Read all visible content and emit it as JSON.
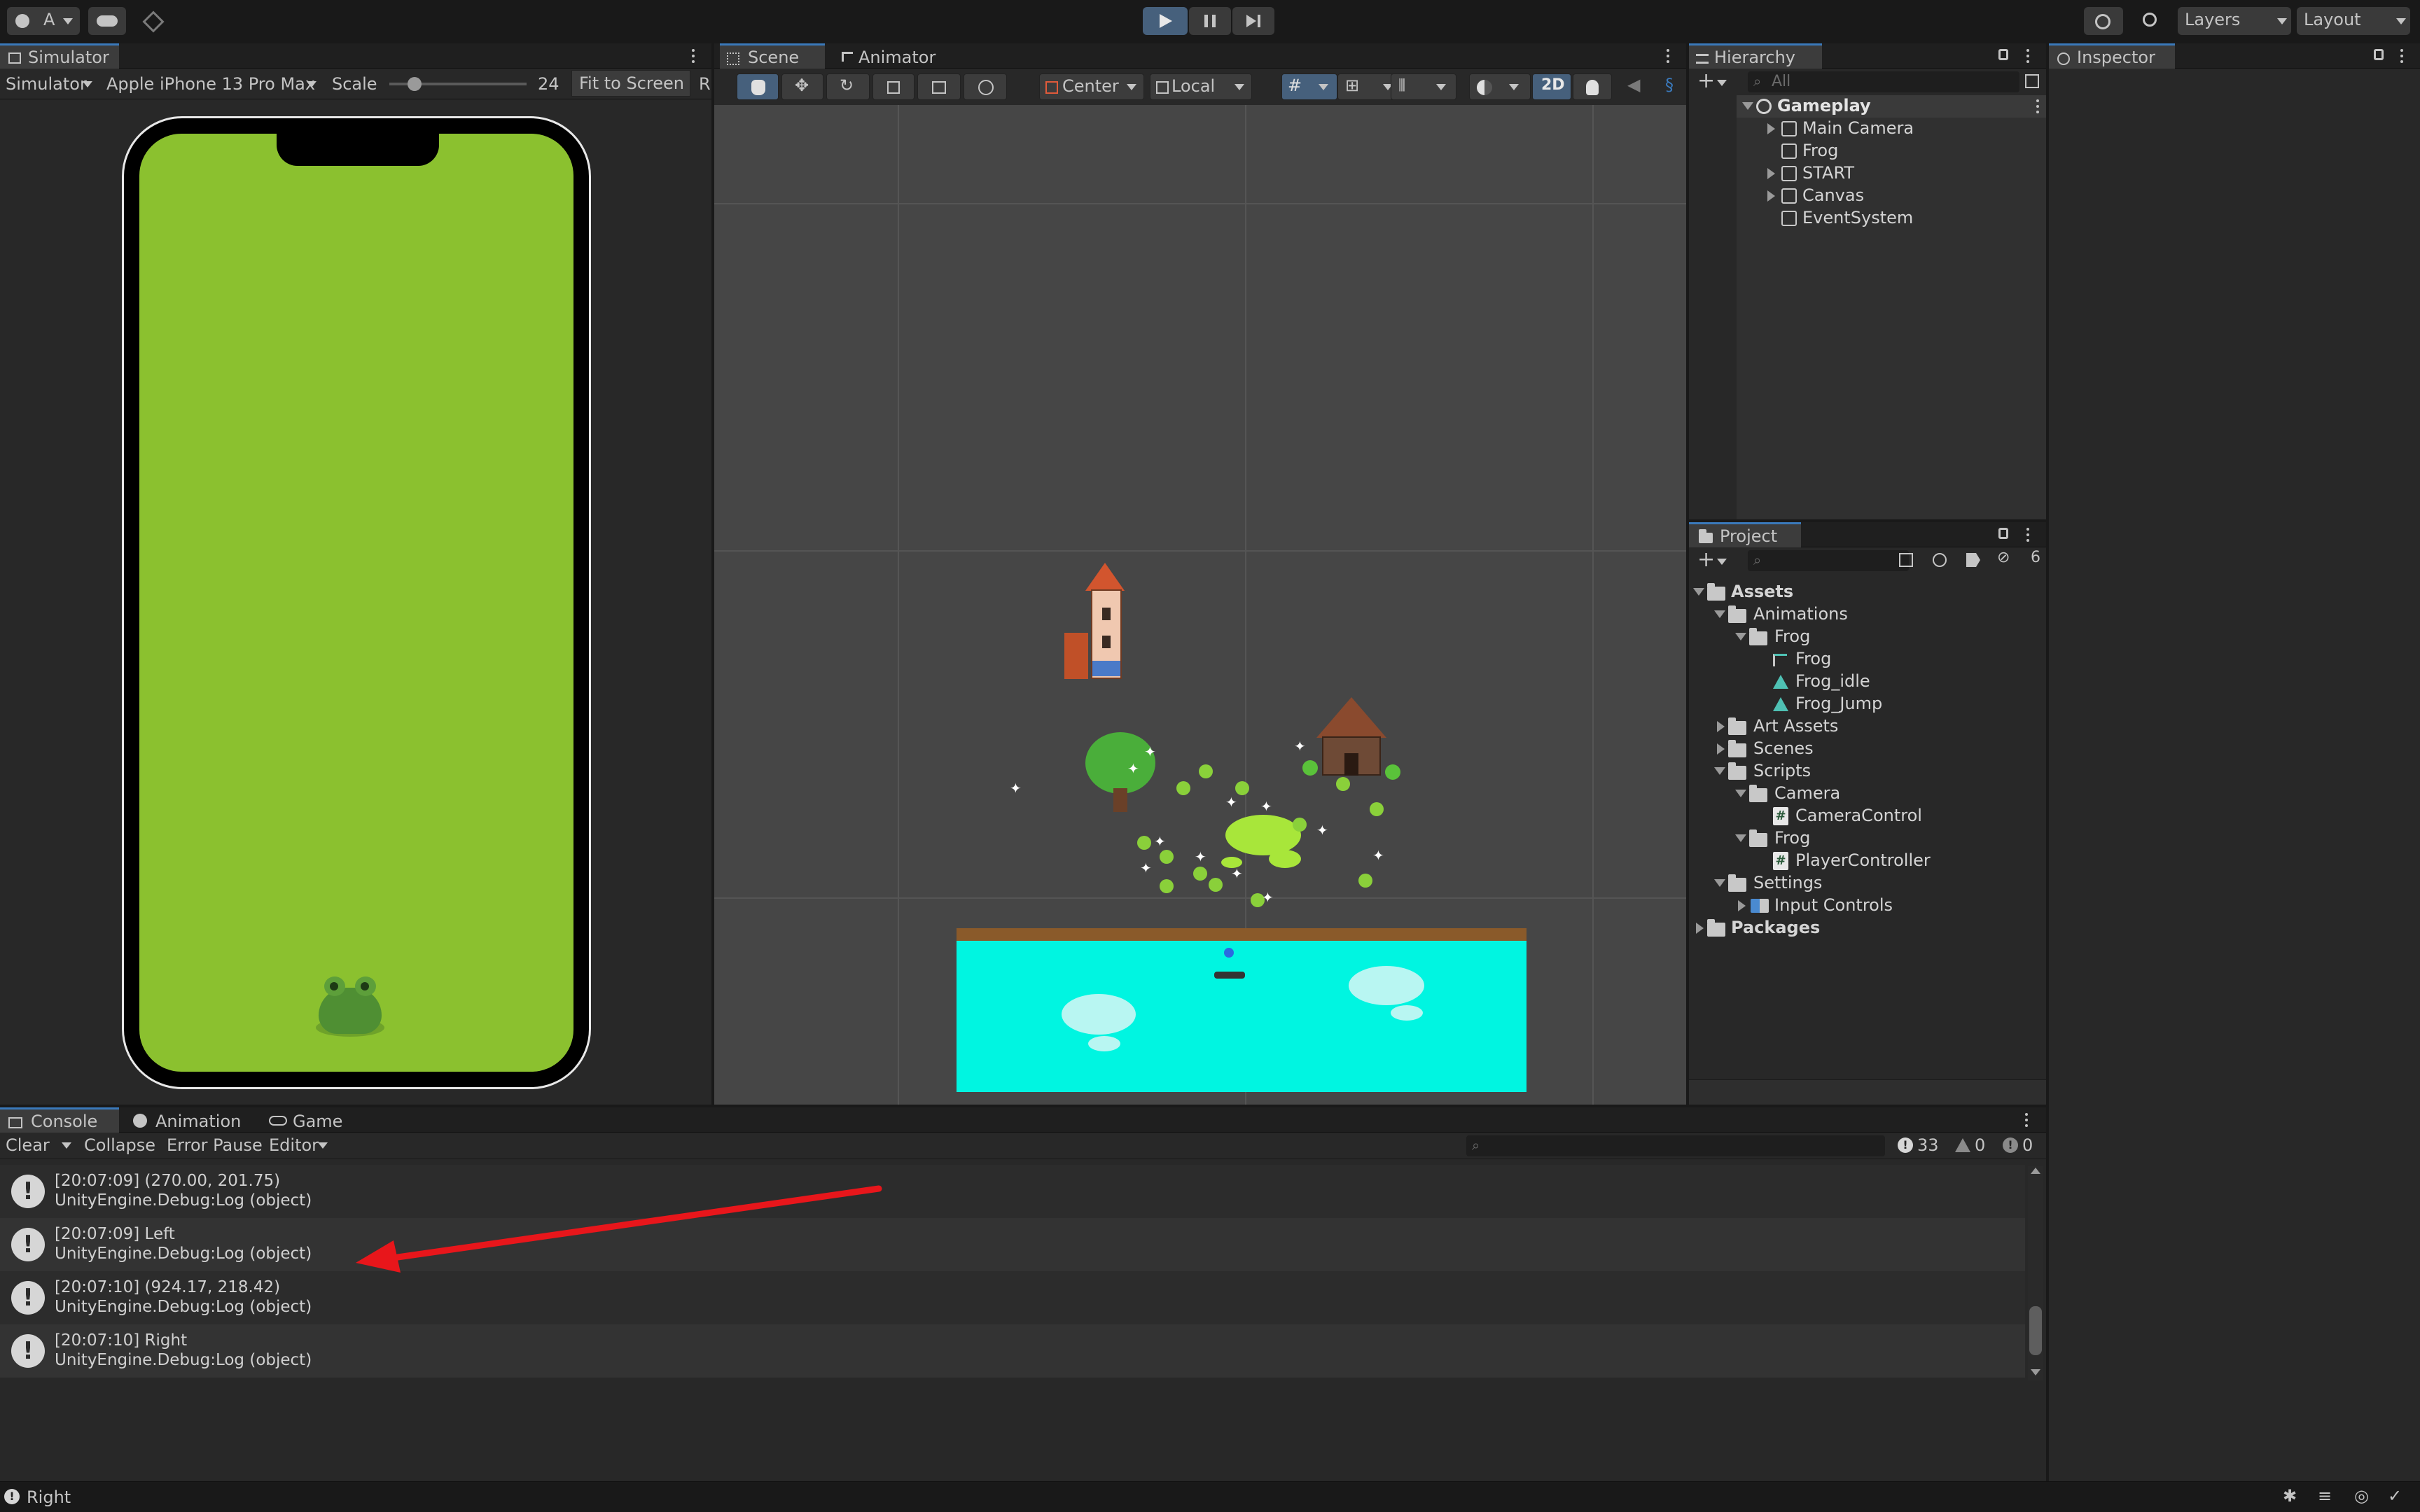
{
  "topbar": {
    "account_label": "A",
    "layers_label": "Layers",
    "layout_label": "Layout"
  },
  "simulator": {
    "tab_label": "Simulator",
    "mode_label": "Simulator",
    "device_label": "Apple iPhone 13 Pro Max",
    "scale_label": "Scale",
    "scale_value": "24",
    "fit_label": "Fit to Screen",
    "rotate_label": "R",
    "screen_color": "#8bc12f"
  },
  "scene": {
    "tabs": [
      "Scene",
      "Animator"
    ],
    "pivot_label": "Center",
    "space_label": "Local",
    "mode_2d_label": "2D"
  },
  "hierarchy": {
    "tab_label": "Hierarchy",
    "search_placeholder": "All",
    "root": "Gameplay",
    "items": [
      "Main Camera",
      "Frog",
      "START",
      "Canvas",
      "EventSystem"
    ]
  },
  "inspector": {
    "tab_label": "Inspector"
  },
  "project": {
    "tab_label": "Project",
    "hidden_count": "6",
    "tree": {
      "assets": "Assets",
      "animations": "Animations",
      "anim_frog_folder": "Frog",
      "anim_frog_controller": "Frog",
      "frog_idle": "Frog_idle",
      "frog_jump": "Frog_Jump",
      "art_assets": "Art Assets",
      "scenes": "Scenes",
      "scripts": "Scripts",
      "camera": "Camera",
      "camera_control": "CameraControl",
      "frog_scripts": "Frog",
      "player_controller": "PlayerController",
      "settings": "Settings",
      "input_controls": "Input Controls",
      "packages": "Packages"
    }
  },
  "console": {
    "tabs": [
      "Console",
      "Animation",
      "Game"
    ],
    "clear_label": "Clear",
    "collapse_label": "Collapse",
    "error_pause_label": "Error Pause",
    "editor_label": "Editor",
    "log_count": "33",
    "warn_count": "0",
    "error_count": "0",
    "logs": [
      {
        "line1": "[20:07:09] (270.00, 201.75)",
        "line2": "UnityEngine.Debug:Log (object)"
      },
      {
        "line1": "[20:07:09] Left",
        "line2": "UnityEngine.Debug:Log (object)"
      },
      {
        "line1": "[20:07:10] (924.17, 218.42)",
        "line2": "UnityEngine.Debug:Log (object)"
      },
      {
        "line1": "[20:07:10] Right",
        "line2": "UnityEngine.Debug:Log (object)"
      }
    ]
  },
  "statusbar": {
    "message": "Right"
  },
  "colors": {
    "accent": "#3a79bb",
    "annotation_arrow": "#e8161b",
    "water": "#00f5e1",
    "grass": "#8bc12f"
  }
}
